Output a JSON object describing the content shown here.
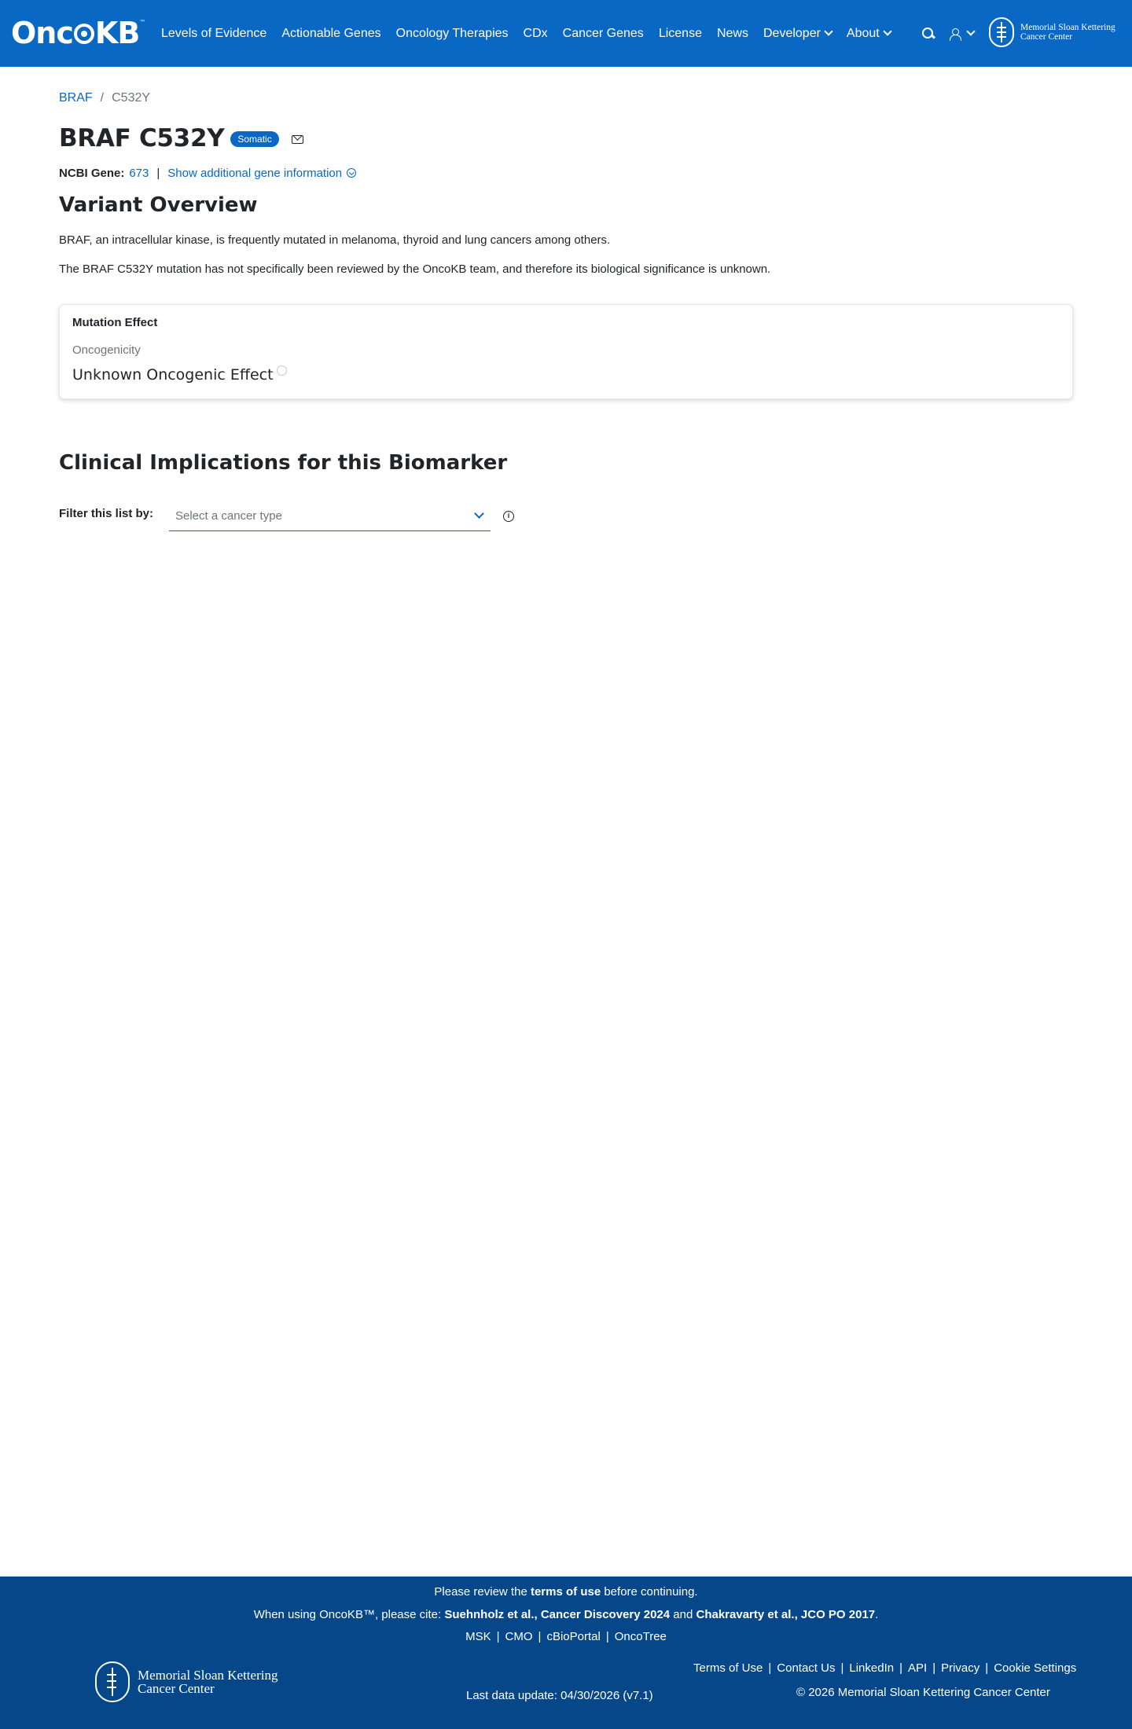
{
  "header": {
    "brand_pre": "Onc",
    "brand_post": "KB",
    "brand_tm": "™",
    "nav": [
      {
        "label": "Levels of Evidence"
      },
      {
        "label": "Actionable Genes"
      },
      {
        "label": "Oncology Therapies"
      },
      {
        "label": "CDx"
      },
      {
        "label": "Cancer Genes"
      },
      {
        "label": "License"
      },
      {
        "label": "News"
      },
      {
        "label": "Developer"
      },
      {
        "label": "About"
      }
    ],
    "msk_line1": "Memorial Sloan Kettering",
    "msk_line2": "Cancer Center"
  },
  "breadcrumb": {
    "gene": "BRAF",
    "separator": "/",
    "variant": "C532Y"
  },
  "title": {
    "text": "BRAF C532Y",
    "badge": "Somatic"
  },
  "gene_info": {
    "label": "NCBI Gene:",
    "id": "673",
    "separator": "|",
    "toggle": "Show additional gene information"
  },
  "overview": {
    "title": "Variant Overview",
    "p1": "BRAF, an intracellular kinase, is frequently mutated in melanoma, thyroid and lung cancers among others.",
    "p2": "The BRAF C532Y mutation has not specifically been reviewed by the OncoKB team, and therefore its biological significance is unknown."
  },
  "mutation_effect": {
    "title": "Mutation Effect",
    "sub": "Oncogenicity",
    "value": "Unknown Oncogenic Effect"
  },
  "clinical": {
    "title": "Clinical Implications for this Biomarker",
    "filter_label": "Filter this list by:",
    "filter_placeholder": "Select a cancer type"
  },
  "footer": {
    "review_pre": "Please review the ",
    "review_link": "terms of use",
    "review_post": " before continuing.",
    "cite_pre": "When using OncoKB™, please cite: ",
    "cite_1": "Suehnholz et al., Cancer Discovery 2024",
    "cite_and": " and ",
    "cite_2": "Chakravarty et al., JCO PO 2017",
    "cite_end": ".",
    "links": [
      "MSK",
      "CMO",
      "cBioPortal",
      "OncoTree"
    ],
    "msk_line1": "Memorial Sloan Kettering",
    "msk_line2": "Cancer Center",
    "last_update": "Last data update: 04/30/2026 (v7.1)",
    "right_links": [
      "Terms of Use",
      "Contact Us",
      "LinkedIn",
      "API",
      "Privacy",
      "Cookie Settings"
    ],
    "copyright": "© 2026 Memorial Sloan Kettering Cancer Center"
  },
  "colors": {
    "primary": "#0968c3",
    "footer_bg": "#064789"
  }
}
